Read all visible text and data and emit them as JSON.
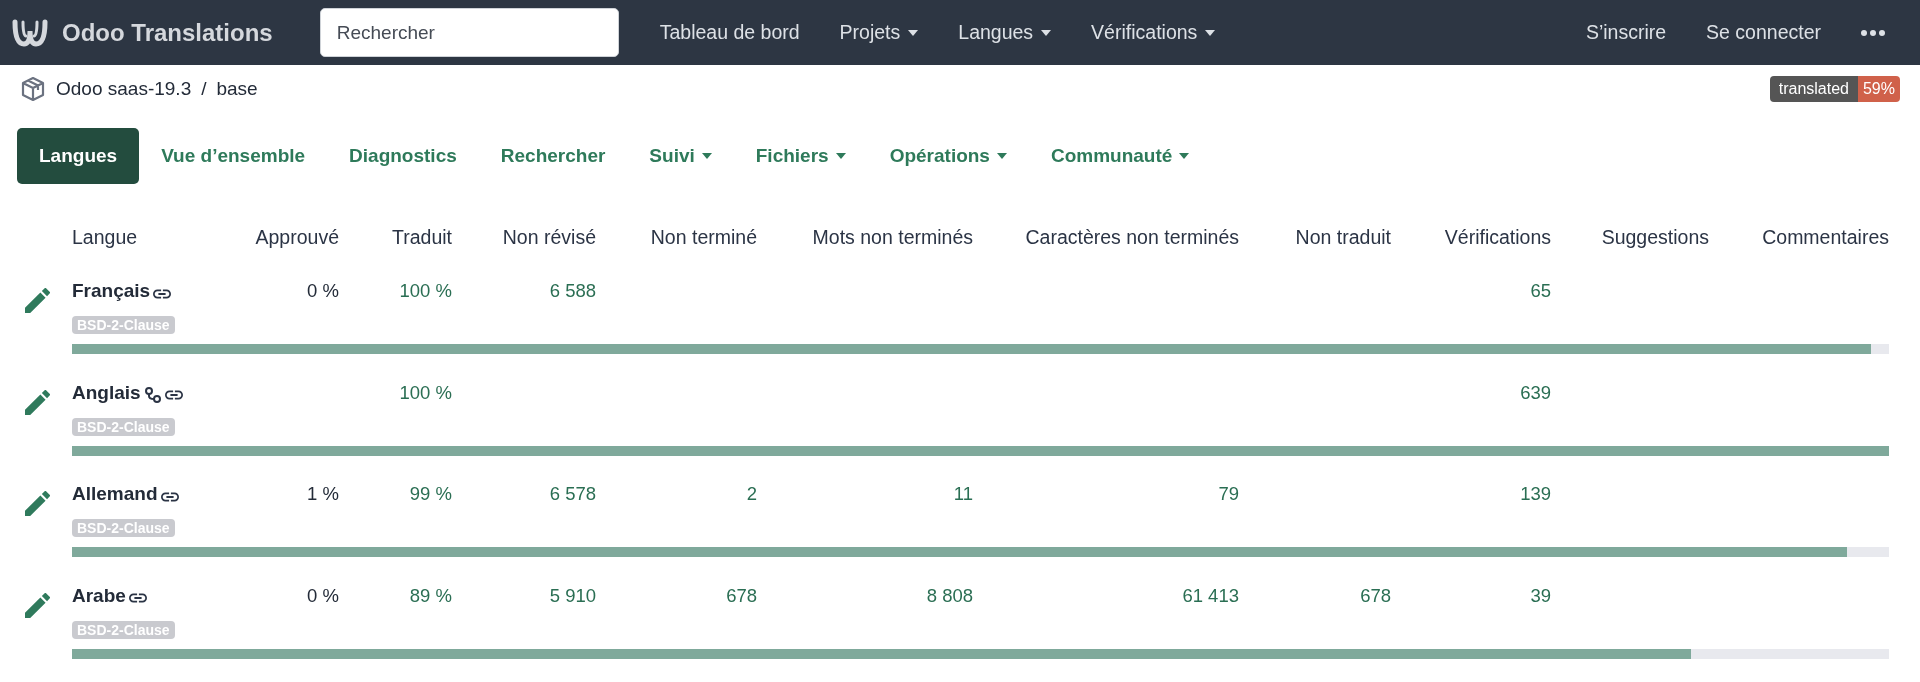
{
  "navbar": {
    "brand": "Odoo Translations",
    "search": {
      "placeholder": "Rechercher"
    },
    "links": [
      {
        "label": "Tableau de bord",
        "dropdown": false
      },
      {
        "label": "Projets",
        "dropdown": true
      },
      {
        "label": "Langues",
        "dropdown": true
      },
      {
        "label": "Vérifications",
        "dropdown": true
      }
    ],
    "account_links": [
      {
        "label": "S’inscrire"
      },
      {
        "label": "Se connecter"
      }
    ]
  },
  "breadcrumb": {
    "items": [
      "Odoo saas-19.3",
      "base"
    ],
    "separator": "/"
  },
  "badge": {
    "label": "translated",
    "value": "59%"
  },
  "tabs": [
    {
      "label": "Langues",
      "selected": true,
      "dropdown": false
    },
    {
      "label": "Vue d’ensemble",
      "selected": false,
      "dropdown": false
    },
    {
      "label": "Diagnostics",
      "selected": false,
      "dropdown": false
    },
    {
      "label": "Rechercher",
      "selected": false,
      "dropdown": false
    },
    {
      "label": "Suivi",
      "selected": false,
      "dropdown": true
    },
    {
      "label": "Fichiers",
      "selected": false,
      "dropdown": true
    },
    {
      "label": "Opérations",
      "selected": false,
      "dropdown": true
    },
    {
      "label": "Communauté",
      "selected": false,
      "dropdown": true
    }
  ],
  "table": {
    "columns": [
      {
        "label": "Langue",
        "kind": "name"
      },
      {
        "label": "Approuvé",
        "kind": "plain"
      },
      {
        "label": "Traduit",
        "kind": "link"
      },
      {
        "label": "Non révisé",
        "kind": "link"
      },
      {
        "label": "Non terminé",
        "kind": "link"
      },
      {
        "label": "Mots non terminés",
        "kind": "link"
      },
      {
        "label": "Caractères non terminés",
        "kind": "link"
      },
      {
        "label": "Non traduit",
        "kind": "link"
      },
      {
        "label": "Vérifications",
        "kind": "link"
      },
      {
        "label": "Suggestions",
        "kind": "link"
      },
      {
        "label": "Commentaires",
        "kind": "link"
      }
    ],
    "rows": [
      {
        "cells": [
          "Français",
          "0 %",
          "100 %",
          "6 588",
          null,
          null,
          null,
          null,
          "65",
          null,
          null
        ],
        "license": "BSD-2-Clause",
        "source": false,
        "level": 0.99
      },
      {
        "cells": [
          "Anglais",
          null,
          "100 %",
          null,
          null,
          null,
          null,
          null,
          "639",
          null,
          null
        ],
        "license": "BSD-2-Clause",
        "source": true,
        "level": 1.0
      },
      {
        "cells": [
          "Allemand",
          "1 %",
          "99 %",
          "6 578",
          "2",
          "11",
          "79",
          null,
          "139",
          null,
          null
        ],
        "license": "BSD-2-Clause",
        "source": false,
        "level": 0.977
      },
      {
        "cells": [
          "Arabe",
          "0 %",
          "89 %",
          "5 910",
          "678",
          "8 808",
          "61 413",
          "678",
          "39",
          null,
          null
        ],
        "license": "BSD-2-Clause",
        "source": false,
        "level": 0.891
      }
    ]
  }
}
